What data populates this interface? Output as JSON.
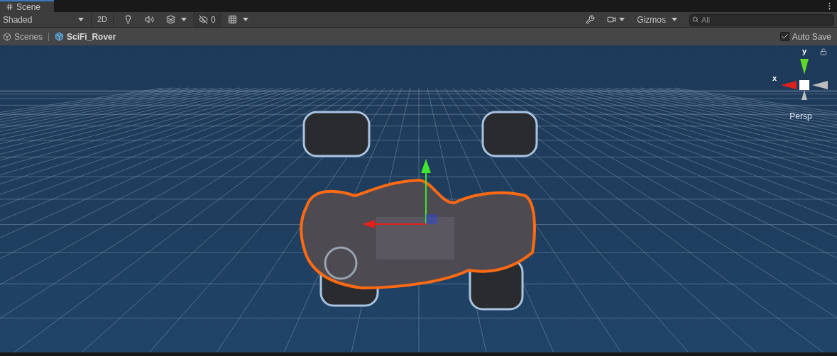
{
  "tab": {
    "label": "Scene",
    "selected": true
  },
  "toolbar": {
    "shading_mode": "Shaded",
    "mode_2d": {
      "label": "2D",
      "on": false
    },
    "hidden_count": "0",
    "gizmos": "Gizmos",
    "search": {
      "placeholder": "All"
    }
  },
  "breadcrumb": [
    {
      "label": "Scenes"
    },
    {
      "label": "SciFi_Rover"
    }
  ],
  "auto_save": {
    "label": "Auto Save",
    "checked": true
  },
  "orientation_gizmo": {
    "y_label": "y",
    "x_label": "x",
    "projection": "Persp",
    "locked": false
  }
}
